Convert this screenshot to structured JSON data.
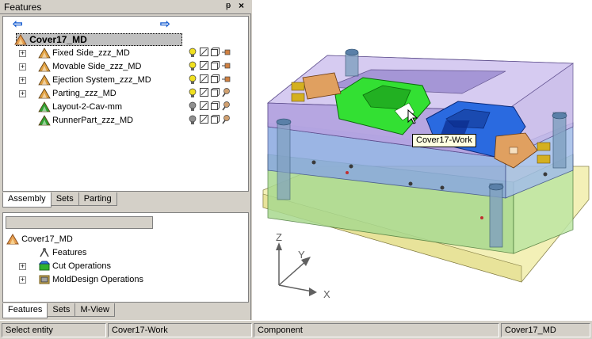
{
  "panel": {
    "title": "Features",
    "pin_glyph": "ᵽ",
    "close_glyph": "×"
  },
  "tree_top": {
    "nav": {
      "back_icon": "arrow-left-icon",
      "forward_icon": "arrow-right-icon"
    },
    "root": "Cover17_MD",
    "items": [
      {
        "label": "Fixed Side_zzz_MD",
        "expandable": true,
        "icon_color": "#e0a040"
      },
      {
        "label": "Movable Side_zzz_MD",
        "expandable": true,
        "icon_color": "#e0a040"
      },
      {
        "label": "Ejection System_zzz_MD",
        "expandable": true,
        "icon_color": "#e0a040"
      },
      {
        "label": "Parting_zzz_MD",
        "expandable": true,
        "icon_color": "#e0a040"
      },
      {
        "label": "Layout-2-Cav-mm",
        "expandable": false,
        "icon_color": "#30a030"
      },
      {
        "label": "RunnerPart_zzz_MD",
        "expandable": false,
        "icon_color": "#30a030"
      }
    ],
    "tabs": [
      "Assembly",
      "Sets",
      "Parting"
    ],
    "active_tab": "Assembly"
  },
  "tree_bottom": {
    "root": "Cover17_MD",
    "items": [
      {
        "label": "Features",
        "expandable": false
      },
      {
        "label": "Cut Operations",
        "expandable": true
      },
      {
        "label": "MoldDesign Operations",
        "expandable": true
      }
    ],
    "tabs": [
      "Features",
      "Sets",
      "M-View"
    ],
    "active_tab": "Features"
  },
  "viewport": {
    "tooltip": "Cover17-Work",
    "axes": {
      "z": "Z",
      "y": "Y",
      "x": "X"
    }
  },
  "status": {
    "prompt": "Select entity",
    "work": "Cover17-Work",
    "mode": "Component",
    "part": "Cover17_MD"
  }
}
